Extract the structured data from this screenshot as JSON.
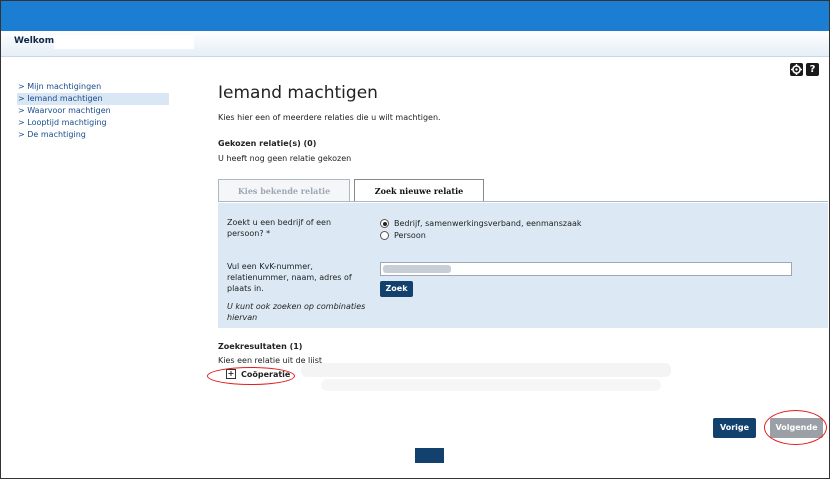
{
  "header": {
    "welcome": "Welkom"
  },
  "sidebar": {
    "items": [
      {
        "label": "> Mijn machtigingen",
        "active": false
      },
      {
        "label": "> Iemand machtigen",
        "active": true
      },
      {
        "label": "> Waarvoor machtigen",
        "active": false
      },
      {
        "label": "> Looptijd machtiging",
        "active": false
      },
      {
        "label": "> De machtiging",
        "active": false
      }
    ]
  },
  "toolbar": {
    "settings_icon": "gear-icon",
    "help_icon": "help-icon",
    "help_glyph": "?"
  },
  "main": {
    "title": "Iemand machtigen",
    "intro": "Kies hier een of meerdere relaties die u wilt machtigen.",
    "chosen_heading": "Gekozen relatie(s) (0)",
    "chosen_text": "U heeft nog geen relatie gekozen"
  },
  "tabs": [
    {
      "label": "Kies bekende relatie",
      "active": false
    },
    {
      "label": "Zoek nieuwe relatie",
      "active": true
    }
  ],
  "search": {
    "question": "Zoekt u een bedrijf of een persoon? *",
    "options": [
      {
        "label": "Bedrijf, samenwerkingsverband, eenmanszaak",
        "checked": true
      },
      {
        "label": "Persoon",
        "checked": false
      }
    ],
    "kvk_label": "Vul een KvK-nummer, relatienummer, naam, adres of plaats in.",
    "kvk_hint": "U kunt ook zoeken op combinaties hiervan",
    "button": "Zoek"
  },
  "results": {
    "heading": "Zoekresultaten (1)",
    "subtext": "Kies een relatie uit de lijst",
    "items": [
      {
        "label": "Coöperatie"
      }
    ]
  },
  "nav": {
    "previous": "Vorige",
    "next": "Volgende"
  },
  "colors": {
    "brand_blue": "#1b7ed3",
    "button_navy": "#12416e",
    "panel_bg": "#dce9f4",
    "highlight_red": "#e02020"
  }
}
